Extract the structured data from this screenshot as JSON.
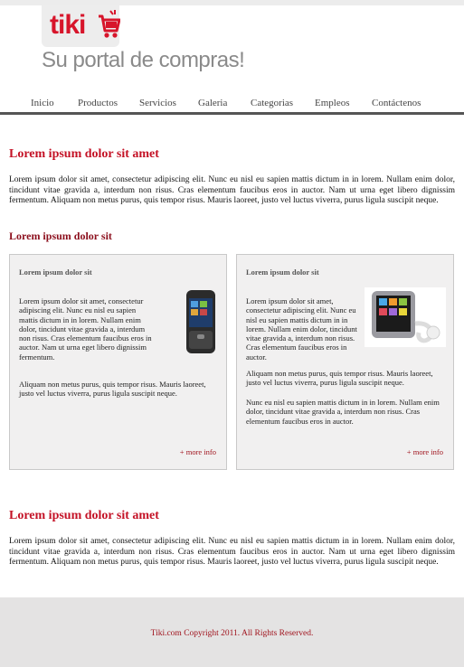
{
  "brand": {
    "logo_text": "tiki",
    "tagline": "Su portal de compras!",
    "accent": "#d7152b"
  },
  "nav": {
    "items": [
      {
        "label": "Inicio"
      },
      {
        "label": "Productos"
      },
      {
        "label": "Servicios"
      },
      {
        "label": "Galeria"
      },
      {
        "label": "Categorias"
      },
      {
        "label": "Empleos"
      },
      {
        "label": "Contáctenos"
      }
    ]
  },
  "section1": {
    "title": "Lorem ipsum dolor sit amet",
    "body": "Lorem ipsum dolor sit amet, consectetur adipiscing elit. Nunc eu nisl eu sapien mattis dictum in in lorem. Nullam enim dolor, tincidunt vitae gravida a, interdum non risus. Cras elementum faucibus eros in auctor. Nam ut urna eget libero dignissim fermentum. Aliquam non metus purus, quis tempor risus. Mauris laoreet, justo vel luctus viverra, purus ligula suscipit neque."
  },
  "products_heading": "Lorem ipsum dolor sit",
  "cards": [
    {
      "title": "Lorem ipsum dolor sit",
      "text1": "Lorem ipsum dolor sit amet, consectetur adipiscing elit. Nunc eu nisl eu sapien mattis dictum in in lorem. Nullam enim dolor, tincidunt vitae gravida a, interdum non risus. Cras elementum faucibus eros in auctor. Nam ut urna eget libero dignissim fermentum.",
      "text2": "Aliquam non metus purus, quis tempor risus. Mauris laoreet, justo vel luctus viverra, purus ligula suscipit neque.",
      "more": "+ more info",
      "image_icon": "smartphone-icon"
    },
    {
      "title": "Lorem ipsum dolor sit",
      "text1": "Lorem ipsum dolor sit amet, consectetur adipiscing elit. Nunc eu nisl eu sapien mattis dictum in in lorem. Nullam enim dolor, tincidunt vitae gravida a, interdum non risus. Cras elementum faucibus eros in auctor.",
      "text2": "Aliquam non metus purus, quis tempor risus. Mauris laoreet, justo vel luctus viverra, purus ligula suscipit neque.",
      "text3": "Nunc eu nisl eu sapien mattis dictum in in lorem. Nullam enim dolor, tincidunt vitae gravida a, interdum non risus. Cras elementum faucibus eros in auctor.",
      "more": "+ more info",
      "image_icon": "music-player-icon"
    }
  ],
  "section2": {
    "title": "Lorem ipsum dolor sit amet",
    "body": "Lorem ipsum dolor sit amet, consectetur adipiscing elit. Nunc eu nisl eu sapien mattis dictum in in lorem. Nullam enim dolor, tincidunt vitae gravida a, interdum non risus. Cras elementum faucibus eros in auctor. Nam ut urna eget libero dignissim fermentum. Aliquam non metus purus, quis tempor risus. Mauris laoreet, justo vel luctus viverra, purus ligula suscipit neque."
  },
  "footer": {
    "copyright": "Tiki.com Copyright 2011. All Rights Reserved."
  }
}
